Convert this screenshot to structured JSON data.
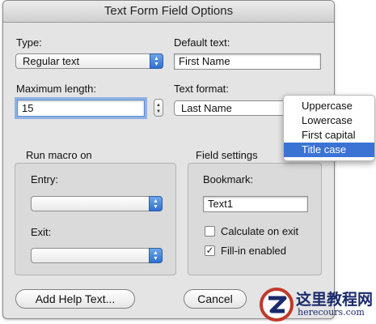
{
  "window": {
    "title": "Text Form Field Options"
  },
  "type": {
    "label": "Type:",
    "value": "Regular text"
  },
  "default_text": {
    "label": "Default text:",
    "value": "First Name"
  },
  "max_length": {
    "label": "Maximum length:",
    "value": "15"
  },
  "text_format": {
    "label": "Text format:",
    "value": "Last Name"
  },
  "format_menu": {
    "items": [
      {
        "label": "Uppercase",
        "selected": false
      },
      {
        "label": "Lowercase",
        "selected": false
      },
      {
        "label": "First capital",
        "selected": false
      },
      {
        "label": "Title case",
        "selected": true
      }
    ]
  },
  "run_macro": {
    "title": "Run macro on",
    "entry_label": "Entry:",
    "exit_label": "Exit:",
    "entry_value": "",
    "exit_value": ""
  },
  "field_settings": {
    "title": "Field settings",
    "bookmark_label": "Bookmark:",
    "bookmark_value": "Text1",
    "calculate_label": "Calculate on exit",
    "calculate_checked": false,
    "fillin_label": "Fill-in enabled",
    "fillin_checked": true
  },
  "buttons": {
    "help": "Add Help Text...",
    "cancel": "Cancel"
  },
  "watermark": {
    "text": "这里教程网",
    "url": "herecours.com"
  },
  "colors": {
    "accent": "#3b73d5",
    "dialog_bg": "#e4e4e4"
  }
}
